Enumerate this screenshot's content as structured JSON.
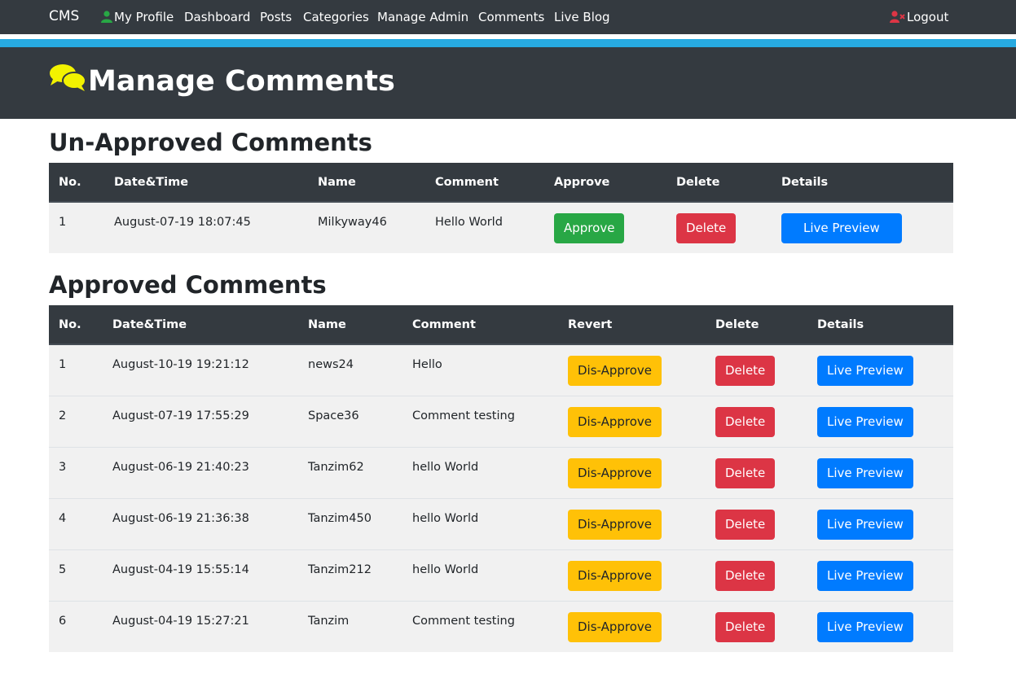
{
  "nav": {
    "brand": "CMS",
    "items": [
      "My Profile",
      "Dashboard",
      "Posts",
      "Categories",
      "Manage Admin",
      "Comments",
      "Live Blog"
    ],
    "logout": "Logout",
    "icons": {
      "profile": "user-icon",
      "logout": "user-times-icon"
    },
    "colors": {
      "profile_icon": "#28a745",
      "logout_icon": "#dc3545"
    }
  },
  "header": {
    "title": "Manage Comments",
    "icon": "comments-icon",
    "icon_color": "#f2f200"
  },
  "unapproved": {
    "heading": "Un-Approved Comments",
    "columns": [
      "No.",
      "Date&Time",
      "Name",
      "Comment",
      "Approve",
      "Delete",
      "Details"
    ],
    "rows": [
      {
        "no": "1",
        "datetime": "August-07-19 18:07:45",
        "name": "Milkyway46",
        "comment": "Hello World",
        "action": "Approve",
        "delete": "Delete",
        "details": "Live Preview"
      }
    ]
  },
  "approved": {
    "heading": "Approved Comments",
    "columns": [
      "No.",
      "Date&Time",
      "Name",
      "Comment",
      "Revert",
      "Delete",
      "Details"
    ],
    "rows": [
      {
        "no": "1",
        "datetime": "August-10-19 19:21:12",
        "name": "news24",
        "comment": "Hello",
        "action": "Dis-Approve",
        "delete": "Delete",
        "details": "Live Preview"
      },
      {
        "no": "2",
        "datetime": "August-07-19 17:55:29",
        "name": "Space36",
        "comment": "Comment testing",
        "action": "Dis-Approve",
        "delete": "Delete",
        "details": "Live Preview"
      },
      {
        "no": "3",
        "datetime": "August-06-19 21:40:23",
        "name": "Tanzim62",
        "comment": "hello World",
        "action": "Dis-Approve",
        "delete": "Delete",
        "details": "Live Preview"
      },
      {
        "no": "4",
        "datetime": "August-06-19 21:36:38",
        "name": "Tanzim450",
        "comment": "hello World",
        "action": "Dis-Approve",
        "delete": "Delete",
        "details": "Live Preview"
      },
      {
        "no": "5",
        "datetime": "August-04-19 15:55:14",
        "name": "Tanzim212",
        "comment": "hello World",
        "action": "Dis-Approve",
        "delete": "Delete",
        "details": "Live Preview"
      },
      {
        "no": "6",
        "datetime": "August-04-19 15:27:21",
        "name": "Tanzim",
        "comment": "Comment testing",
        "action": "Dis-Approve",
        "delete": "Delete",
        "details": "Live Preview"
      }
    ]
  },
  "colors": {
    "navbar": "#343a40",
    "accent": "#27aae1",
    "approve": "#28a745",
    "delete": "#dc3545",
    "preview": "#007bff",
    "disapprove": "#ffc107"
  }
}
